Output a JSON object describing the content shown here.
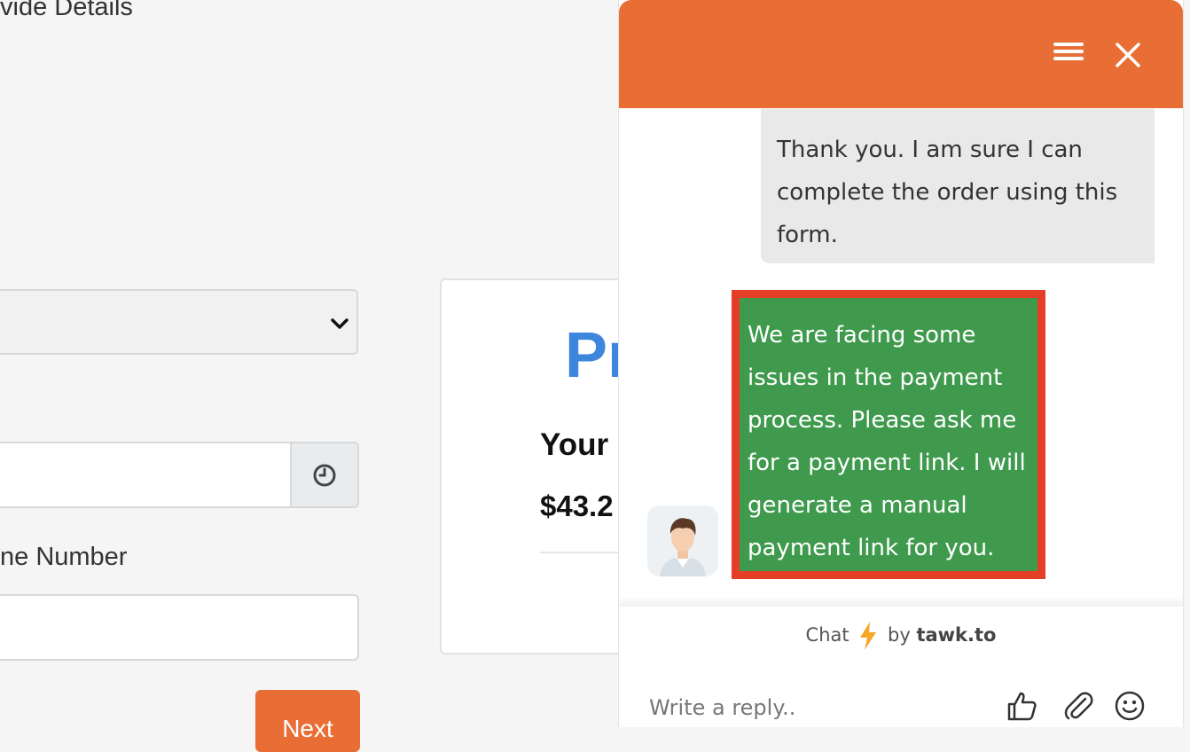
{
  "form": {
    "section_title": "vide Details",
    "phone_label": "ne Number",
    "next_button": "Next"
  },
  "summary": {
    "heading": "Pr",
    "subheading": "Your",
    "price": "$43.2"
  },
  "chat": {
    "incoming_message": "Thank you. I am sure I can complete the order using this form.",
    "agent_message": "We are facing some issues in the payment process. Please ask me for a payment link. I will generate a manual payment link for you.",
    "branding": {
      "prefix": "Chat",
      "by": "by",
      "brand": "tawk.to"
    },
    "reply_placeholder": "Write a reply..",
    "colors": {
      "header": "#e86e35",
      "agent_bubble": "#3f9a4d",
      "agent_border": "#e43f26",
      "incoming_bubble": "#e9e9e9"
    }
  },
  "icons": [
    "chevron-down-icon",
    "clock-icon",
    "menu-icon",
    "close-icon",
    "avatar",
    "lightning-icon",
    "thumbs-up-icon",
    "paperclip-icon",
    "smiley-icon"
  ]
}
